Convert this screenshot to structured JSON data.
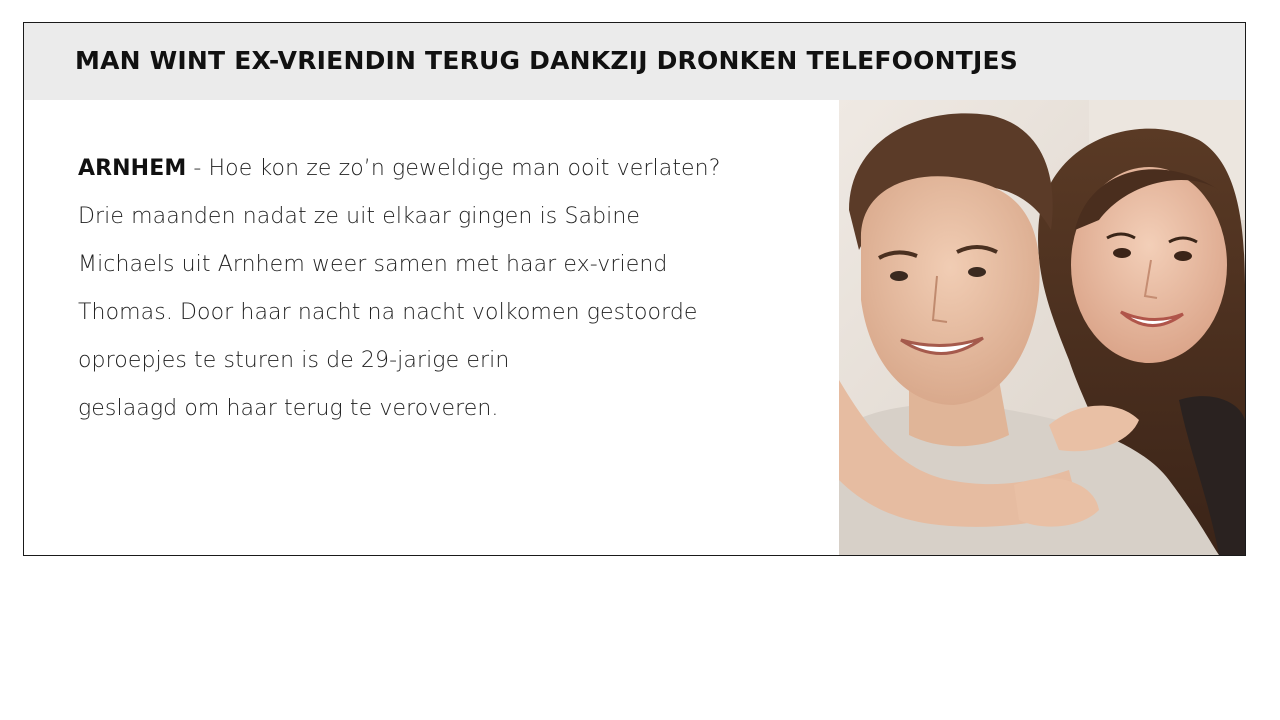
{
  "article": {
    "headline": "MAN WINT EX-VRIENDIN TERUG DANKZIJ DRONKEN TELEFOONTJES",
    "dateline": "ARNHEM",
    "body_lines": [
      " - Hoe kon ze zo’n geweldige man ooit verlaten?",
      "Drie maanden nadat ze uit elkaar gingen is Sabine",
      "Michaels uit Arnhem weer samen met haar ex-vriend",
      "Thomas. Door haar nacht na nacht volkomen gestoorde",
      "oproepjes te sturen is de 29-jarige erin",
      "geslaagd om haar terug te veroveren."
    ],
    "photo": {
      "subject": "smiling couple, woman hugging man from behind"
    }
  },
  "colors": {
    "headline_bar": "#ebebeb",
    "card_border": "#1a1a1a",
    "text": "#222222"
  }
}
